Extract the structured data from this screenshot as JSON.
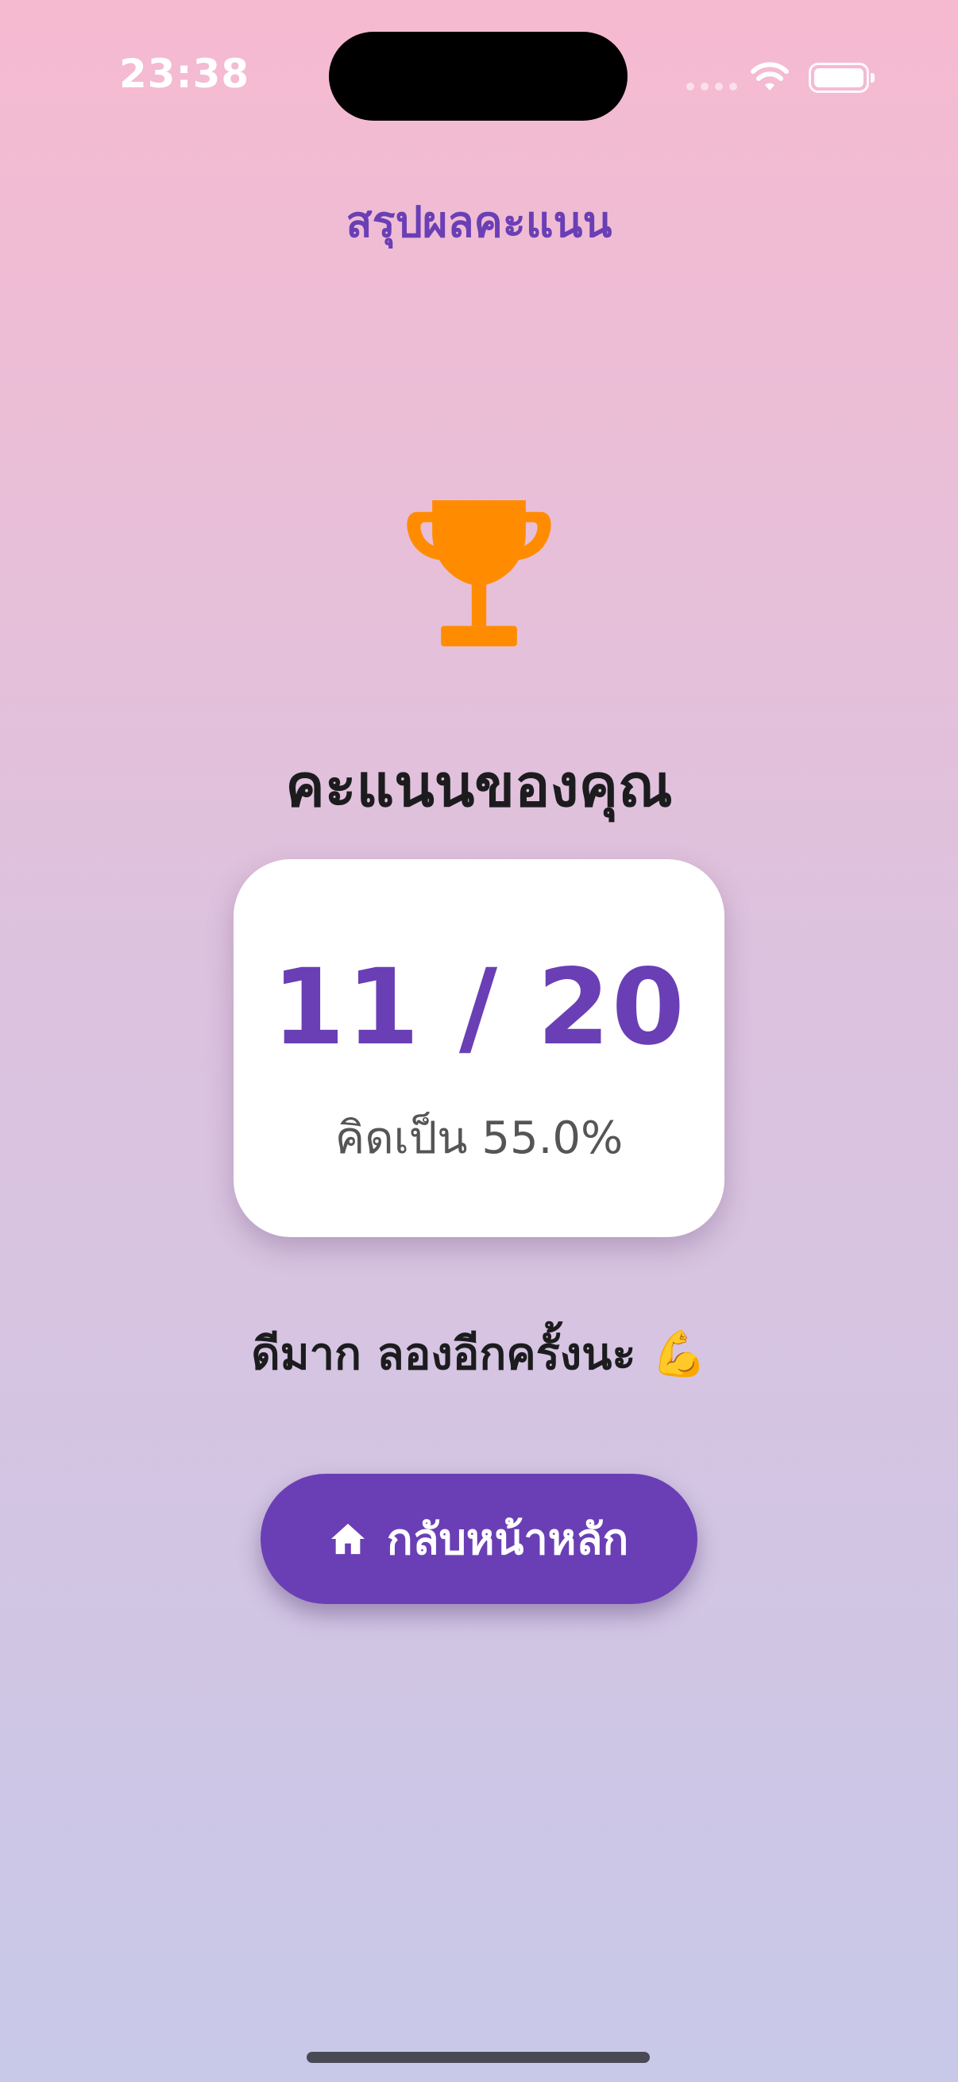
{
  "status_bar": {
    "time": "23:38"
  },
  "header": {
    "title": "สรุปผลคะแนน"
  },
  "result": {
    "heading": "คะแนนของคุณ",
    "score_text": "11 / 20",
    "score": 11,
    "total": 20,
    "percent_text": "คิดเป็น 55.0%",
    "feedback": "ดีมาก ลองอีกครั้งนะ 💪"
  },
  "actions": {
    "home_label": "กลับหน้าหลัก"
  },
  "icons": {
    "trophy": "trophy-icon",
    "home": "home-icon"
  },
  "colors": {
    "accent": "#6a3fb5",
    "trophy": "#ff8c00",
    "background_top": "#f6bad0",
    "background_bottom": "#c8c8e8"
  }
}
